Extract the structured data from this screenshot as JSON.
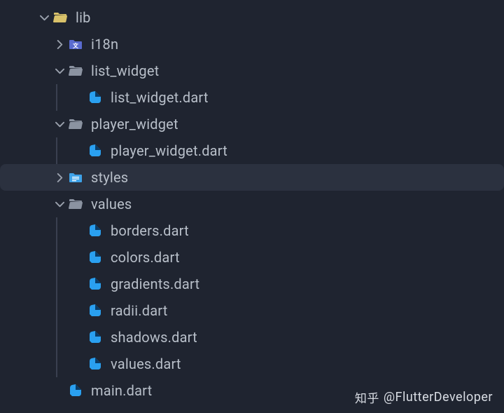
{
  "tree": {
    "lib": {
      "label": "lib"
    },
    "i18n": {
      "label": "i18n"
    },
    "list_widget": {
      "label": "list_widget"
    },
    "list_widget_dart": {
      "label": "list_widget.dart"
    },
    "player_widget": {
      "label": "player_widget"
    },
    "player_widget_dart": {
      "label": "player_widget.dart"
    },
    "styles": {
      "label": "styles"
    },
    "values": {
      "label": "values"
    },
    "borders_dart": {
      "label": "borders.dart"
    },
    "colors_dart": {
      "label": "colors.dart"
    },
    "gradients_dart": {
      "label": "gradients.dart"
    },
    "radii_dart": {
      "label": "radii.dart"
    },
    "shadows_dart": {
      "label": "shadows.dart"
    },
    "values_dart": {
      "label": "values.dart"
    },
    "main_dart": {
      "label": "main.dart"
    }
  },
  "colors": {
    "folder_yellow": "#d9c26a",
    "folder_grey": "#8b93a1",
    "folder_i18n": "#5a6bcf",
    "folder_styles": "#3ea2e8",
    "dart_blue": "#2aa0f0",
    "dart_dark": "#0a3b66"
  },
  "watermark": {
    "site": "知乎",
    "handle": "@FlutterDeveloper"
  }
}
